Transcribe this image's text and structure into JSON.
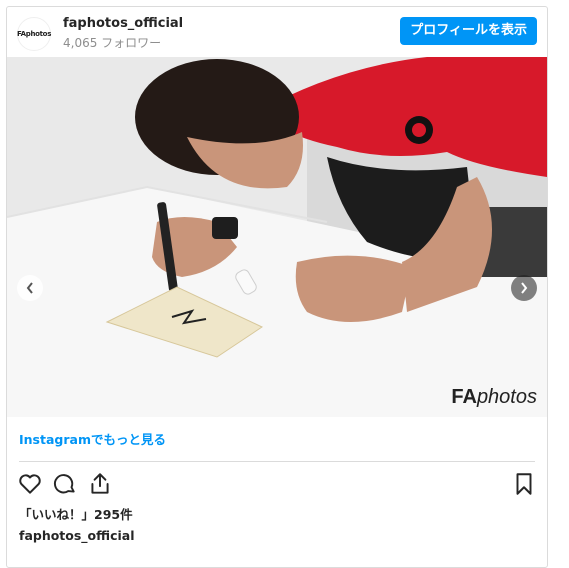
{
  "header": {
    "avatar_text": "FAphotos",
    "username": "faphotos_official",
    "followers": "4,065 フォロワー",
    "profile_button": "プロフィールを表示"
  },
  "photo": {
    "watermark_bold": "FA",
    "watermark_rest": "photos",
    "shirt_color": "#d7192a",
    "nav_prev_icon": "chevron-left-icon",
    "nav_next_icon": "chevron-right-icon"
  },
  "more_link": "Instagramでもっと見る",
  "actions": {
    "icons": [
      "heart-icon",
      "comment-icon",
      "share-icon",
      "bookmark-icon"
    ]
  },
  "likes_text": "「いいね！」295件",
  "owner": "faphotos_official",
  "colors": {
    "accent": "#0095f6",
    "border": "#dbdbdb",
    "muted": "#8e8e8e"
  }
}
